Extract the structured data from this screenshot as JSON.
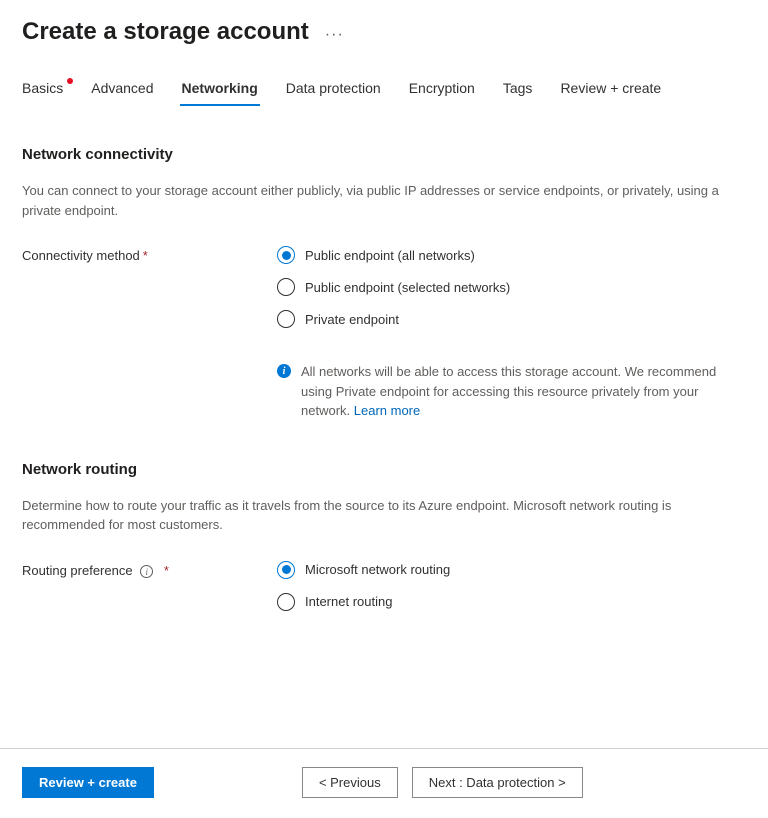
{
  "header": {
    "title": "Create a storage account"
  },
  "tabs": [
    {
      "label": "Basics",
      "has_dot": true,
      "active": false
    },
    {
      "label": "Advanced",
      "has_dot": false,
      "active": false
    },
    {
      "label": "Networking",
      "has_dot": false,
      "active": true
    },
    {
      "label": "Data protection",
      "has_dot": false,
      "active": false
    },
    {
      "label": "Encryption",
      "has_dot": false,
      "active": false
    },
    {
      "label": "Tags",
      "has_dot": false,
      "active": false
    },
    {
      "label": "Review + create",
      "has_dot": false,
      "active": false
    }
  ],
  "sections": {
    "connectivity": {
      "heading": "Network connectivity",
      "description": "You can connect to your storage account either publicly, via public IP addresses or service endpoints, or privately, using a private endpoint.",
      "field_label": "Connectivity method",
      "options": [
        {
          "label": "Public endpoint (all networks)",
          "selected": true
        },
        {
          "label": "Public endpoint (selected networks)",
          "selected": false
        },
        {
          "label": "Private endpoint",
          "selected": false
        }
      ],
      "info_text": "All networks will be able to access this storage account. We recommend using Private endpoint for accessing this resource privately from your network. ",
      "info_link": "Learn more"
    },
    "routing": {
      "heading": "Network routing",
      "description": "Determine how to route your traffic as it travels from the source to its Azure endpoint. Microsoft network routing is recommended for most customers.",
      "field_label": "Routing preference",
      "options": [
        {
          "label": "Microsoft network routing",
          "selected": true
        },
        {
          "label": "Internet routing",
          "selected": false
        }
      ]
    }
  },
  "footer": {
    "review_create": "Review + create",
    "previous": "< Previous",
    "next": "Next : Data protection >"
  }
}
